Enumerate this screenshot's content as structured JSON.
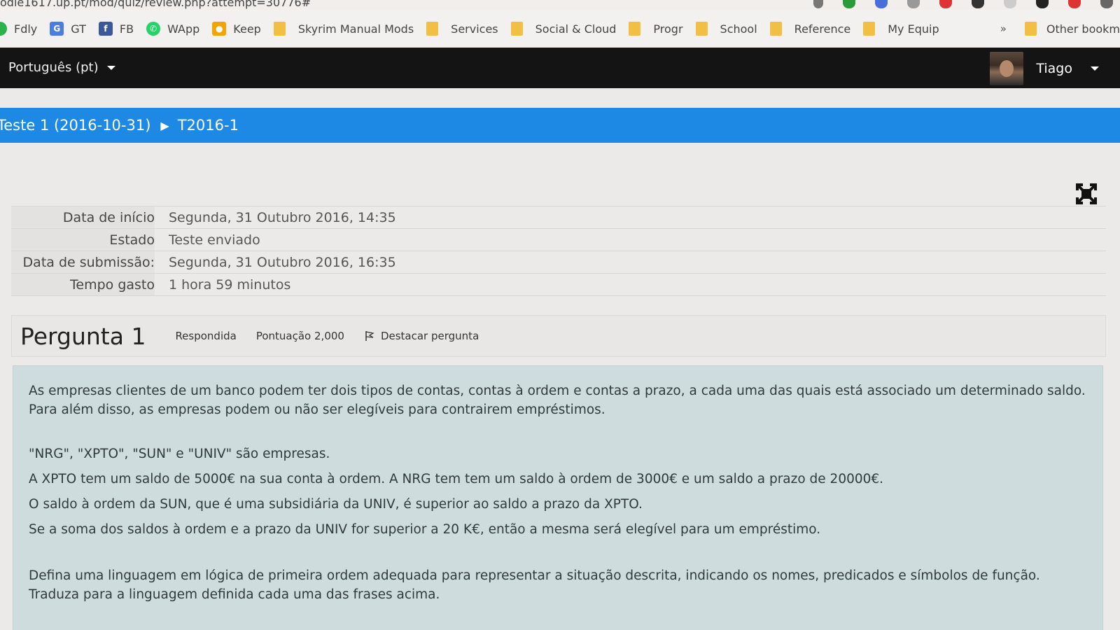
{
  "browser": {
    "url": "odle1617.up.pt/mod/quiz/review.php?attempt=30776#",
    "bookmarks": [
      {
        "label": "Fdly",
        "icon": "feedly-icon",
        "color": "#2bb24c"
      },
      {
        "label": "GT",
        "icon": "google-translate-icon",
        "color": "#4a7de0"
      },
      {
        "label": "FB",
        "icon": "facebook-icon",
        "color": "#3b5998"
      },
      {
        "label": "WApp",
        "icon": "whatsapp-icon",
        "color": "#25d366"
      },
      {
        "label": "Keep",
        "icon": "keep-icon",
        "color": "#f4b400"
      },
      {
        "label": "Skyrim Manual Mods",
        "icon": "folder-icon"
      },
      {
        "label": "Services",
        "icon": "folder-icon"
      },
      {
        "label": "Social & Cloud",
        "icon": "folder-icon"
      },
      {
        "label": "Progr",
        "icon": "folder-icon"
      },
      {
        "label": "School",
        "icon": "folder-icon"
      },
      {
        "label": "Reference",
        "icon": "folder-icon"
      },
      {
        "label": "My Equip",
        "icon": "folder-icon"
      }
    ],
    "more_label": "»",
    "other_bookmarks": "Other bookm"
  },
  "nav": {
    "language": "Português (pt)",
    "user_name": "Tiago"
  },
  "breadcrumb": {
    "items": [
      "Teste 1 (2016-10-31)",
      "T2016-1"
    ],
    "separator": "▶"
  },
  "summary": {
    "rows": [
      {
        "label": "Data de início",
        "value": "Segunda, 31 Outubro 2016, 14:35"
      },
      {
        "label": "Estado",
        "value": "Teste enviado"
      },
      {
        "label": "Data de submissão:",
        "value": "Segunda, 31 Outubro 2016, 16:35"
      },
      {
        "label": "Tempo gasto",
        "value": "1 hora 59 minutos"
      }
    ]
  },
  "question": {
    "title": "Pergunta 1",
    "status": "Respondida",
    "score": "Pontuação 2,000",
    "flag_label": "Destacar pergunta",
    "intro": "As empresas clientes de um banco podem ter dois tipos de contas, contas à ordem e contas a prazo, a cada uma das quais está associado um determinado saldo. Para além disso, as empresas podem ou não ser elegíveis para contrairem empréstimos.",
    "sentences": [
      "\"NRG\", \"XPTO\", \"SUN\" e \"UNIV\" são empresas.",
      "A XPTO tem um saldo de 5000€ na sua conta à ordem. A NRG tem tem um saldo à ordem de 3000€ e um saldo a prazo de 20000€.",
      "O saldo à ordem da SUN, que é uma subsidiária da UNIV, é superior ao saldo a prazo da XPTO.",
      "Se a soma dos saldos à ordem e a prazo da UNIV for superior a 20 K€, então a mesma será elegível para um empréstimo."
    ],
    "instruction": "Defina uma linguagem em lógica de primeira ordem adequada para representar a situação descrita, indicando os nomes, predicados e símbolos de função. Traduza para a linguagem definida cada uma das frases acima."
  },
  "colors": {
    "accent": "#1e88e5",
    "navbar": "#141414",
    "question_bg": "#cfdcdd"
  }
}
